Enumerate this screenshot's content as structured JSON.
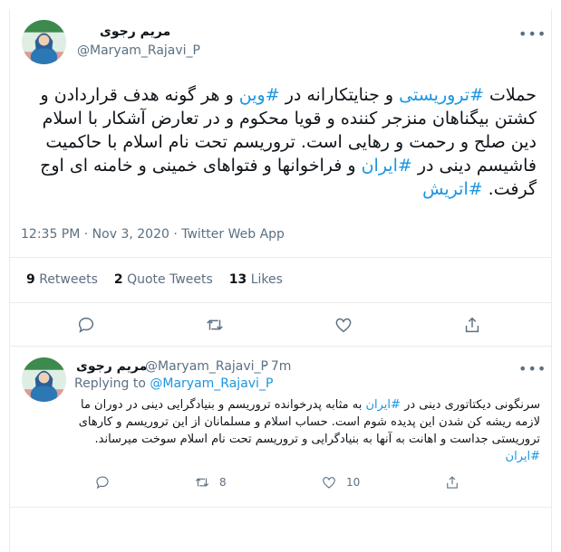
{
  "tweet": {
    "author_name": "مریم رجوی",
    "author_handle": "@Maryam_Rajavi_P",
    "more_glyph": "•••",
    "text_parts": [
      {
        "t": "حملات ",
        "tag": false
      },
      {
        "t": "#تروریستی",
        "tag": true
      },
      {
        "t": " و جنایتکارانه در ",
        "tag": false
      },
      {
        "t": "#وین",
        "tag": true
      },
      {
        "t": " و هر گونه هدف قراردادن و کشتن بیگناهان منزجر کننده و قویا محکوم و در تعارض آشکار با اسلام دین صلح و رحمت و رهایی است. تروریسم تحت نام اسلام با حاکمیت فاشیسم دینی در ",
        "tag": false
      },
      {
        "t": "#ایران",
        "tag": true
      },
      {
        "t": " و فراخوانها و فتواهای خمینی و خامنه ای اوج گرفت. ",
        "tag": false
      },
      {
        "t": "#اتریش",
        "tag": true
      }
    ],
    "timestamp": "12:35 PM · Nov 3, 2020 · Twitter Web App",
    "stats": {
      "retweets_count": "9",
      "retweets_label": "Retweets",
      "quotes_count": "2",
      "quotes_label": "Quote Tweets",
      "likes_count": "13",
      "likes_label": "Likes"
    },
    "actions": [
      "reply-icon",
      "retweet-icon",
      "like-icon",
      "share-icon"
    ]
  },
  "reply": {
    "author_name": "مریم رجوی",
    "author_handle": "@Maryam_Rajavi_P",
    "time": "· 7m",
    "more_glyph": "•••",
    "replying_prefix": "Replying to ",
    "replying_handle": "@Maryam_Rajavi_P",
    "text_parts": [
      {
        "t": "سرنگونی دیکتاتوری دینی در ",
        "tag": false
      },
      {
        "t": "#ایران",
        "tag": true
      },
      {
        "t": " به مثابه پدرخوانده تروریسم و بنیادگرایی دینی در دوران ما لازمه ریشه کن شدن این پدیده شوم است. حساب اسلام و مسلمانان از این تروریسم و کارهای تروریستی جداست و اهانت به آنها به بنیادگرایی و تروریسم تحت نام اسلام سوخت میرساند. ",
        "tag": false
      },
      {
        "t": "#ایران",
        "tag": true
      }
    ],
    "retweets": "8",
    "likes": "10"
  }
}
